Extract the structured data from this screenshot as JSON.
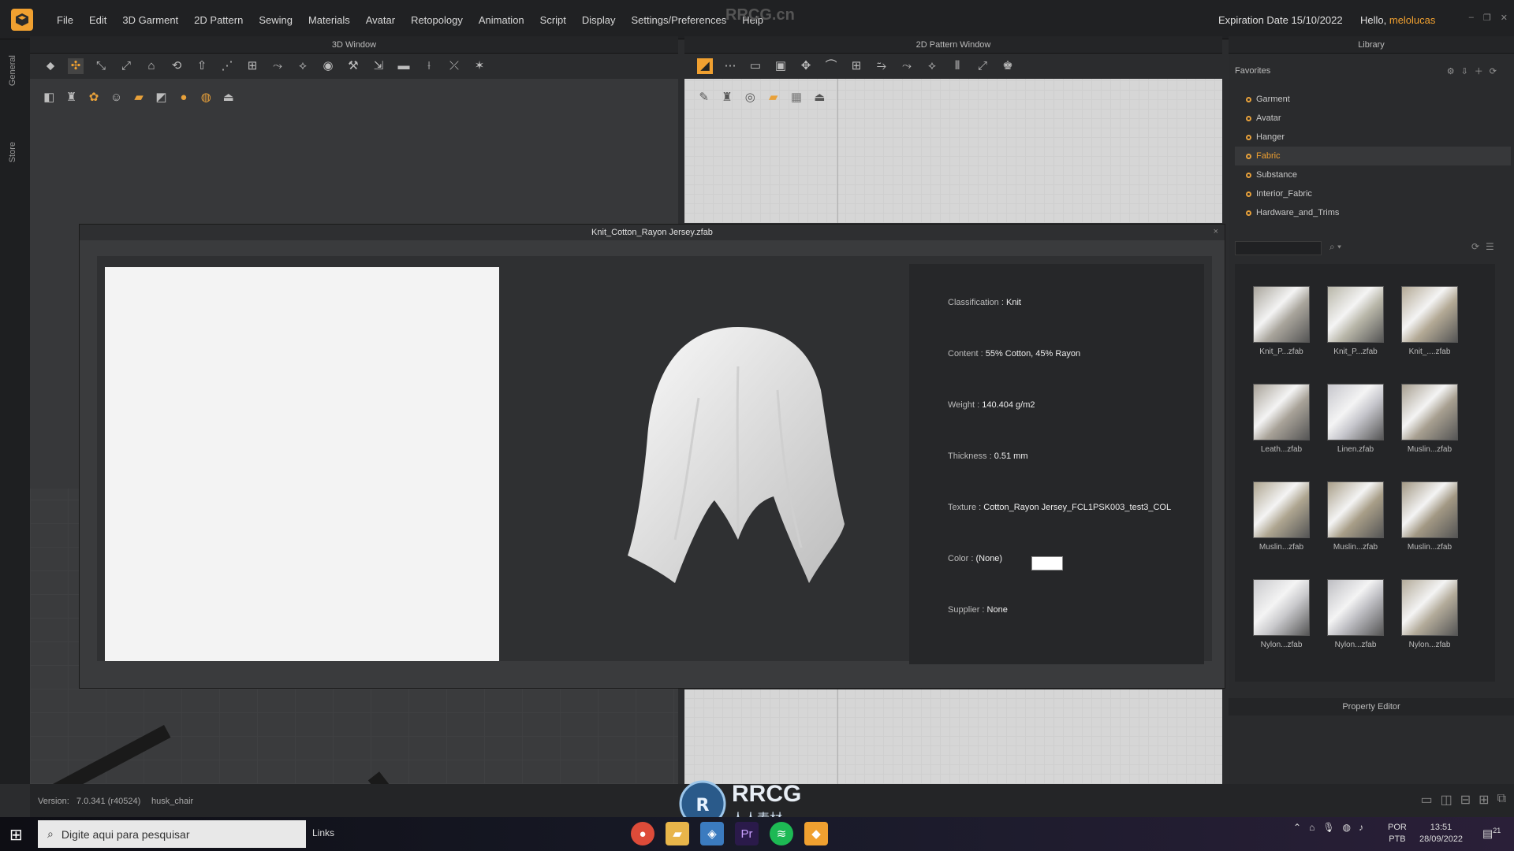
{
  "menubar": {
    "items": [
      "File",
      "Edit",
      "3D Garment",
      "2D Pattern",
      "Sewing",
      "Materials",
      "Avatar",
      "Retopology",
      "Animation",
      "Script",
      "Display",
      "Settings/Preferences",
      "Help"
    ],
    "watermark": "RRCG.cn",
    "expiration": "Expiration Date 15/10/2022",
    "hello": "Hello, ",
    "username": "melolucas"
  },
  "siderail": {
    "tabs": [
      "General",
      "Store"
    ]
  },
  "windows": {
    "view3d_title": "3D Window",
    "view2d_title": "2D Pattern Window",
    "library_title": "Library",
    "property_title": "Property Editor"
  },
  "library": {
    "favorites_label": "Favorites",
    "favorites": [
      "Garment",
      "Avatar",
      "Hanger",
      "Fabric",
      "Substance",
      "Interior_Fabric",
      "Hardware_and_Trims"
    ],
    "active": "Fabric",
    "thumbnails": [
      "Knit_P...zfab",
      "Knit_P...zfab",
      "Knit_....zfab",
      "Leath...zfab",
      "Linen.zfab",
      "Muslin...zfab",
      "Muslin...zfab",
      "Muslin...zfab",
      "Muslin...zfab",
      "Nylon...zfab",
      "Nylon...zfab",
      "Nylon...zfab"
    ],
    "thumb_colors": [
      "#a9a59c",
      "#b8b6a8",
      "#b3a995",
      "#a8a298",
      "#c6c6cc",
      "#a79f90",
      "#aea590",
      "#a89e88",
      "#a29884",
      "#c9c9cc",
      "#bdbdc2",
      "#b3ab9a"
    ]
  },
  "modal": {
    "title": "Knit_Cotton_Rayon Jersey.zfab",
    "close": "×",
    "info": [
      {
        "label": "Classification : ",
        "value": "Knit"
      },
      {
        "label": "Content : ",
        "value": "55% Cotton, 45% Rayon"
      },
      {
        "label": "Weight : ",
        "value": "140.404 g/m2"
      },
      {
        "label": "Thickness : ",
        "value": "0.51 mm"
      },
      {
        "label": "Texture : ",
        "value": "Cotton_Rayon Jersey_FCL1PSK003_test3_COL"
      },
      {
        "label": "Color : ",
        "value": "(None)"
      },
      {
        "label": "Supplier : ",
        "value": "None"
      }
    ]
  },
  "status": {
    "version_label": "Version:",
    "version": "7.0.341 (r40524)",
    "avatar": "husk_chair"
  },
  "taskbar": {
    "search_placeholder": "Digite aqui para pesquisar",
    "links": "Links",
    "lang1": "POR",
    "lang2": "PTB",
    "time": "13:51",
    "date": "28/09/2022",
    "notif_count": "21"
  },
  "overlay": {
    "brand": "RRCG",
    "brand_sub": "人人素材"
  }
}
